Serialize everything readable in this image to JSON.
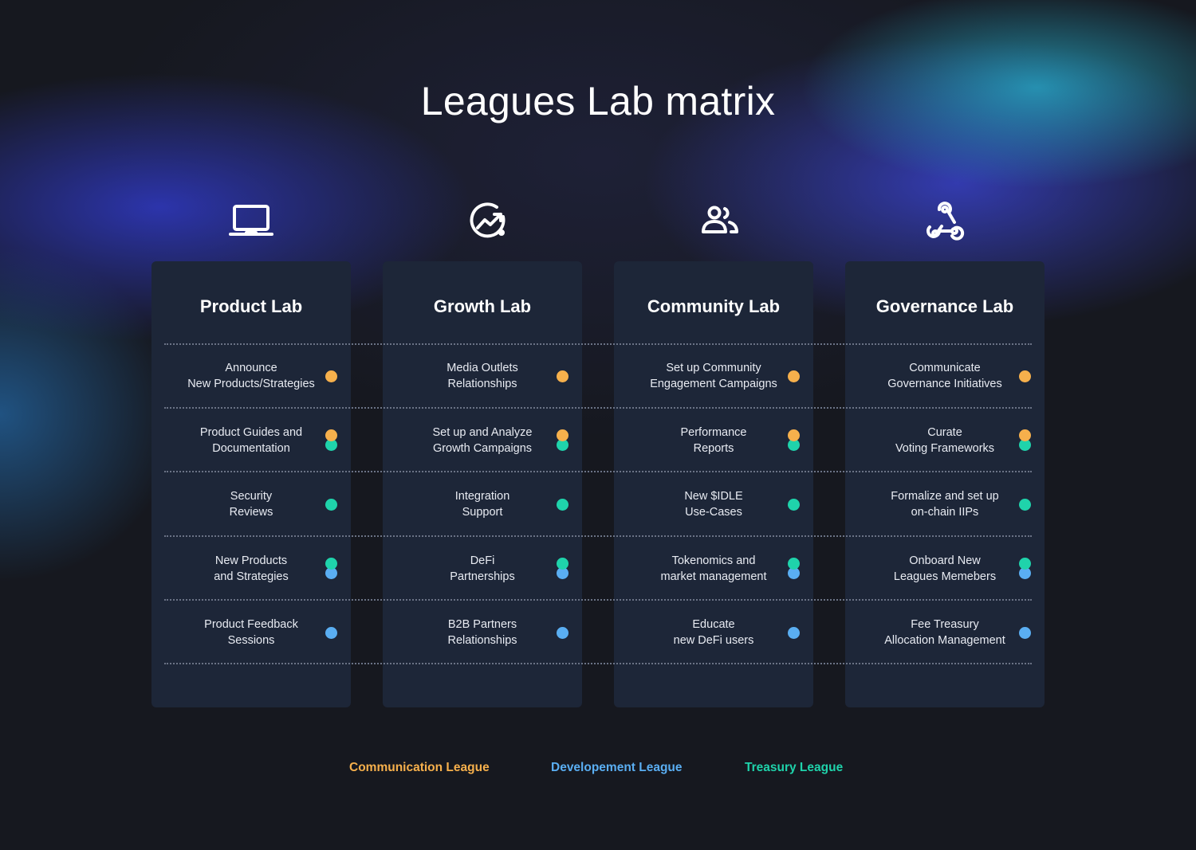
{
  "title": "Leagues Lab matrix",
  "colors": {
    "communication": "#f6b04c",
    "development": "#5aaef2",
    "treasury": "#1fd3ab"
  },
  "legend": [
    {
      "label": "Communication League",
      "color": "#f6b04c"
    },
    {
      "label": "Developement League",
      "color": "#5aaef2"
    },
    {
      "label": "Treasury League",
      "color": "#1fd3ab"
    }
  ],
  "labs": [
    {
      "icon": "laptop-icon",
      "title": "Product Lab",
      "items": [
        {
          "label": "Announce\nNew Products/Strategies",
          "leagues": [
            "communication"
          ]
        },
        {
          "label": "Product Guides and\nDocumentation",
          "leagues": [
            "communication",
            "treasury"
          ]
        },
        {
          "label": "Security\nReviews",
          "leagues": [
            "treasury"
          ]
        },
        {
          "label": "New Products\nand Strategies",
          "leagues": [
            "treasury",
            "development"
          ]
        },
        {
          "label": "Product Feedback\nSessions",
          "leagues": [
            "development"
          ]
        }
      ]
    },
    {
      "icon": "growth-chart-icon",
      "title": "Growth Lab",
      "items": [
        {
          "label": "Media Outlets\nRelationships",
          "leagues": [
            "communication"
          ]
        },
        {
          "label": "Set up and Analyze\nGrowth Campaigns",
          "leagues": [
            "communication",
            "treasury"
          ]
        },
        {
          "label": "Integration\nSupport",
          "leagues": [
            "treasury"
          ]
        },
        {
          "label": "DeFi\nPartnerships",
          "leagues": [
            "treasury",
            "development"
          ]
        },
        {
          "label": "B2B Partners\nRelationships",
          "leagues": [
            "development"
          ]
        }
      ]
    },
    {
      "icon": "users-icon",
      "title": "Community Lab",
      "items": [
        {
          "label": "Set up Community\nEngagement Campaigns",
          "leagues": [
            "communication"
          ]
        },
        {
          "label": "Performance\nReports",
          "leagues": [
            "communication",
            "treasury"
          ]
        },
        {
          "label": "New $IDLE\nUse-Cases",
          "leagues": [
            "treasury"
          ]
        },
        {
          "label": "Tokenomics and\nmarket management",
          "leagues": [
            "treasury",
            "development"
          ]
        },
        {
          "label": "Educate\nnew DeFi users",
          "leagues": [
            "development"
          ]
        }
      ]
    },
    {
      "icon": "webhook-icon",
      "title": "Governance Lab",
      "items": [
        {
          "label": "Communicate\nGovernance Initiatives",
          "leagues": [
            "communication"
          ]
        },
        {
          "label": "Curate\nVoting Frameworks",
          "leagues": [
            "communication",
            "treasury"
          ]
        },
        {
          "label": "Formalize and set up\non-chain IIPs",
          "leagues": [
            "treasury"
          ]
        },
        {
          "label": "Onboard New\nLeagues Memebers",
          "leagues": [
            "treasury",
            "development"
          ]
        },
        {
          "label": "Fee Treasury\nAllocation Management",
          "leagues": [
            "development"
          ]
        }
      ]
    }
  ]
}
